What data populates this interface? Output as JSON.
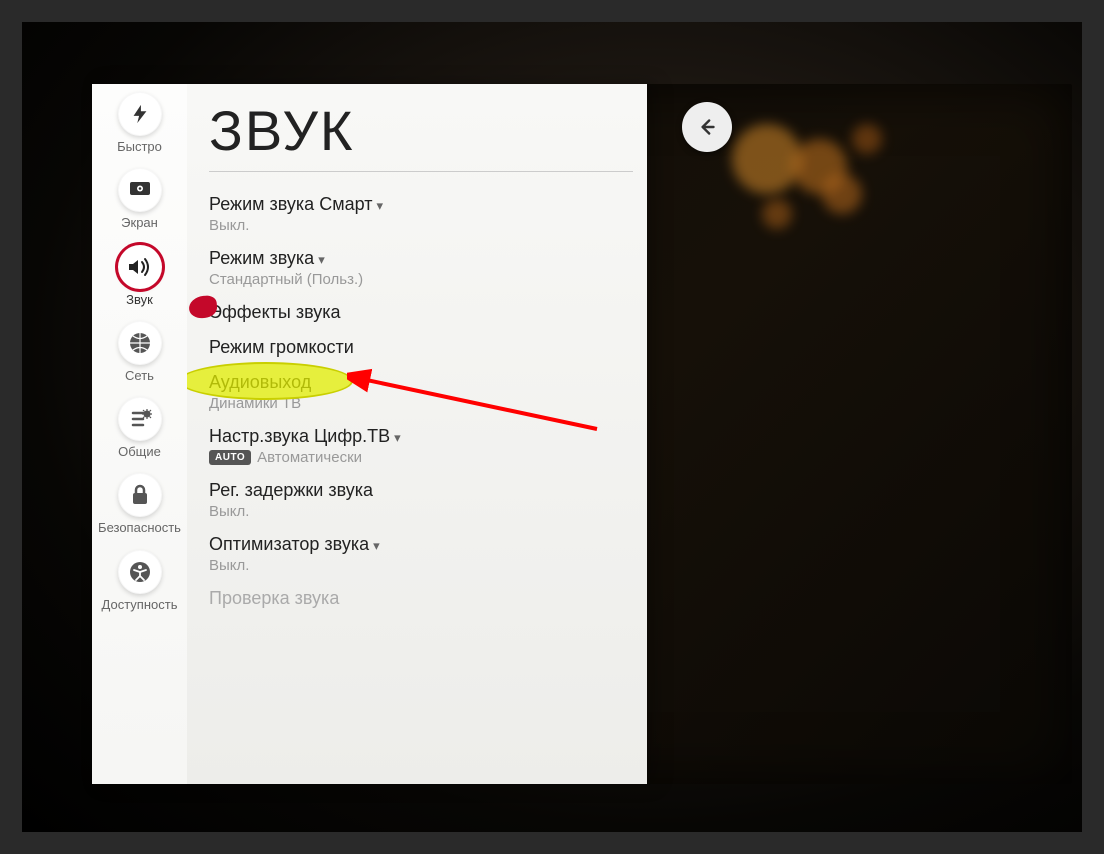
{
  "sidebar": {
    "items": [
      {
        "label": "Быстро",
        "icon": "lightning-icon"
      },
      {
        "label": "Экран",
        "icon": "screen-icon"
      },
      {
        "label": "Звук",
        "icon": "sound-icon"
      },
      {
        "label": "Сеть",
        "icon": "network-icon"
      },
      {
        "label": "Общие",
        "icon": "general-icon"
      },
      {
        "label": "Безопасность",
        "icon": "lock-icon"
      },
      {
        "label": "Доступность",
        "icon": "accessibility-icon"
      }
    ],
    "active_index": 2
  },
  "page": {
    "title": "ЗВУК"
  },
  "options": [
    {
      "title": "Режим звука Смарт",
      "value": "Выкл.",
      "has_dropdown": true
    },
    {
      "title": "Режим звука",
      "value": "Стандартный (Польз.)",
      "has_dropdown": true
    },
    {
      "title": "Эффекты звука",
      "value": null,
      "has_dropdown": false,
      "highlighted": true
    },
    {
      "title": "Режим громкости",
      "value": null,
      "has_dropdown": false
    },
    {
      "title": "Аудиовыход",
      "value": "Динамики ТВ",
      "has_dropdown": false
    },
    {
      "title": "Настр.звука Цифр.ТВ",
      "value": "Автоматически",
      "has_dropdown": true,
      "badge": "AUTO"
    },
    {
      "title": "Рег. задержки звука",
      "value": "Выкл.",
      "has_dropdown": false
    },
    {
      "title": "Оптимизатор звука",
      "value": "Выкл.",
      "has_dropdown": true
    },
    {
      "title": "Проверка звука",
      "value": null,
      "has_dropdown": false,
      "disabled": true
    }
  ],
  "back_button": {
    "label": "back"
  }
}
